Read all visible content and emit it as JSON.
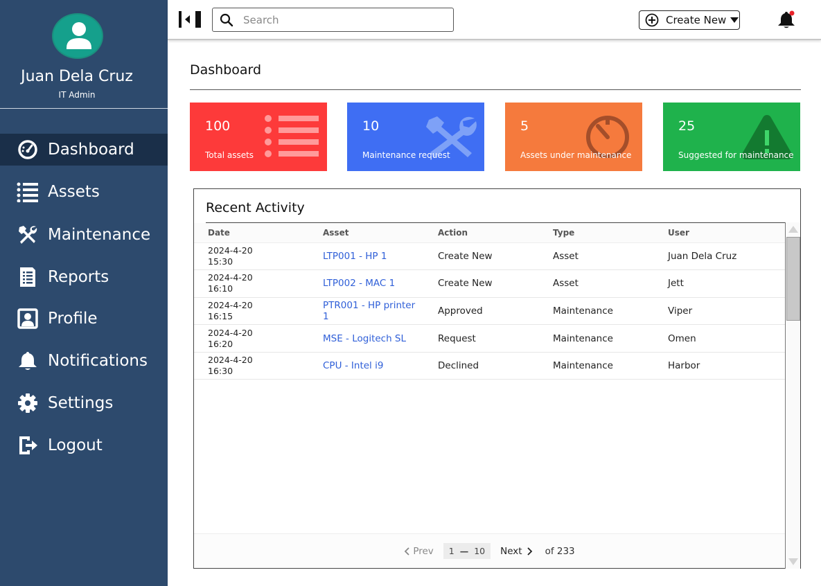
{
  "user": {
    "name": "Juan Dela Cruz",
    "role": "IT Admin"
  },
  "sidebar": {
    "items": [
      {
        "label": "Dashboard",
        "icon": "gauge-icon",
        "active": true
      },
      {
        "label": "Assets",
        "icon": "list-icon"
      },
      {
        "label": "Maintenance",
        "icon": "tools-icon"
      },
      {
        "label": "Reports",
        "icon": "report-icon"
      },
      {
        "label": "Profile",
        "icon": "profile-icon"
      },
      {
        "label": "Notifications",
        "icon": "bell-icon"
      },
      {
        "label": "Settings",
        "icon": "gear-icon"
      },
      {
        "label": "Logout",
        "icon": "logout-icon"
      }
    ]
  },
  "topbar": {
    "search_placeholder": "Search",
    "create_label": "Create New",
    "bell_has_alert": true
  },
  "page": {
    "title": "Dashboard"
  },
  "cards": [
    {
      "value": "100",
      "label": "Total assets",
      "color": "#fd3a3a",
      "icon": "list-icon"
    },
    {
      "value": "10",
      "label": "Maintenance request",
      "color": "#3f6ef3",
      "icon": "tools-icon"
    },
    {
      "value": "5",
      "label": "Assets under maintenance",
      "color": "#f57a3d",
      "icon": "timer-icon"
    },
    {
      "value": "25",
      "label": "Suggested for maintenance",
      "color": "#1fb24c",
      "icon": "warning-icon"
    }
  ],
  "activity": {
    "title": "Recent Activity",
    "columns": [
      "Date",
      "Asset",
      "Action",
      "Type",
      "User"
    ],
    "rows": [
      {
        "date": "2024-4-20",
        "time": "15:30",
        "asset": "LTP001 - HP 1",
        "action": "Create New",
        "type": "Asset",
        "user": "Juan Dela Cruz"
      },
      {
        "date": "2024-4-20",
        "time": "16:10",
        "asset": "LTP002 - MAC 1",
        "action": "Create New",
        "type": "Asset",
        "user": "Jett"
      },
      {
        "date": "2024-4-20",
        "time": "16:15",
        "asset": "PTR001 - HP printer 1",
        "action": "Approved",
        "type": "Maintenance",
        "user": "Viper"
      },
      {
        "date": "2024-4-20",
        "time": "16:20",
        "asset": "MSE - Logitech SL",
        "action": "Request",
        "type": "Maintenance",
        "user": "Omen"
      },
      {
        "date": "2024-4-20",
        "time": "16:30",
        "asset": "CPU - Intel i9",
        "action": "Declined",
        "type": "Maintenance",
        "user": "Harbor"
      }
    ],
    "pager": {
      "prev": "Prev",
      "range_start": "1",
      "range_end": "10",
      "next": "Next",
      "of": "of 233"
    }
  },
  "colors": {
    "sidebar": "#2d4a6d",
    "sidebar_active": "#1a2f49",
    "avatar": "#15a08c",
    "link": "#2f5fd8"
  }
}
